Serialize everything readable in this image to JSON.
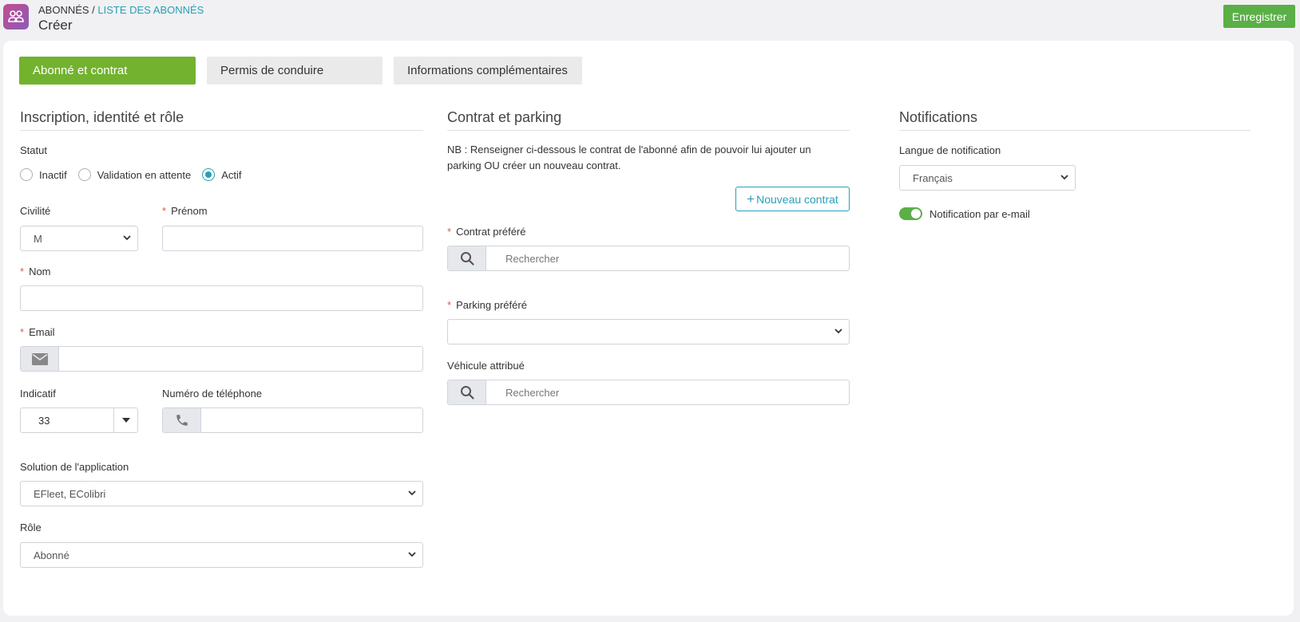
{
  "header": {
    "breadcrumb_root": "ABONNÉS /",
    "breadcrumb_link": "LISTE DES ABONNÉS",
    "title": "Créer",
    "save_label": "Enregistrer",
    "app_icon": "users-icon"
  },
  "tabs": [
    {
      "label": "Abonné et contrat",
      "active": true
    },
    {
      "label": "Permis de conduire",
      "active": false
    },
    {
      "label": "Informations complémentaires",
      "active": false
    }
  ],
  "identity": {
    "section_title": "Inscription, identité et rôle",
    "status_label": "Statut",
    "status_options": [
      {
        "label": "Inactif",
        "checked": false
      },
      {
        "label": "Validation en attente",
        "checked": false
      },
      {
        "label": "Actif",
        "checked": true
      }
    ],
    "civility_label": "Civilité",
    "civility_value": "M",
    "firstname_label": "Prénom",
    "firstname_value": "",
    "lastname_label": "Nom",
    "lastname_value": "",
    "email_label": "Email",
    "email_value": "",
    "dial_code_label": "Indicatif",
    "dial_code_value": "33",
    "phone_label": "Numéro de téléphone",
    "phone_value": "",
    "app_solution_label": "Solution de l'application",
    "app_solution_value": "EFleet, EColibri",
    "role_label": "Rôle",
    "role_value": "Abonné",
    "required_mark": "*"
  },
  "contract": {
    "section_title": "Contrat et parking",
    "note_line1": "NB : Renseigner ci-dessous le contrat de l'abonné afin de pouvoir lui ajouter un",
    "note_line2": "parking OU créer un nouveau contrat.",
    "new_contract_label": "Nouveau contrat",
    "preferred_contract_label": "Contrat préféré",
    "preferred_contract_placeholder": "Rechercher",
    "preferred_parking_label": "Parking préféré",
    "preferred_parking_value": "",
    "vehicle_label": "Véhicule attribué",
    "vehicle_placeholder": "Rechercher"
  },
  "notifications": {
    "section_title": "Notifications",
    "language_label": "Langue de notification",
    "language_value": "Français",
    "email_toggle_label": "Notification par e-mail",
    "email_toggle_on": true
  },
  "colors": {
    "accent_teal": "#27a0b5",
    "active_tab_green": "#73b22f",
    "save_green": "#5aaf47",
    "required_red": "#e05a4a"
  }
}
